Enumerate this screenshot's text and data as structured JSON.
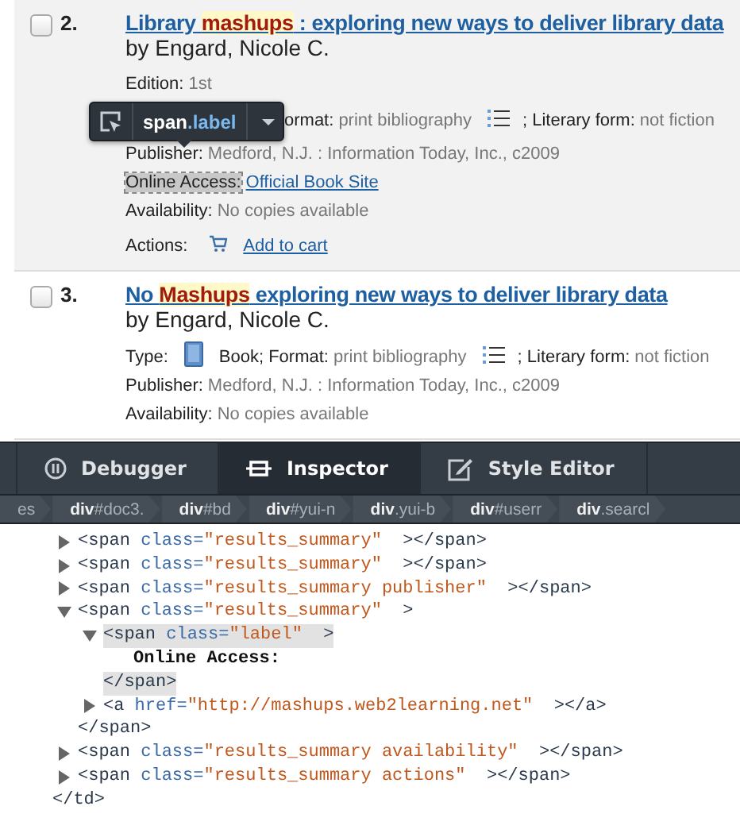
{
  "records": [
    {
      "number": "2.",
      "checked": false,
      "shaded": true,
      "title": [
        {
          "text": "Library ",
          "highlight": false
        },
        {
          "text": "mashups",
          "highlight": true
        },
        {
          "text": " : exploring new ways to deliver library data",
          "highlight": false
        }
      ],
      "author": "by Engard, Nicole C.",
      "rows": [
        {
          "kind": "plain",
          "parts": [
            {
              "kind": "label",
              "text": "Edition:",
              "highlighted": false
            },
            {
              "kind": "value",
              "text": "1st"
            }
          ]
        },
        {
          "kind": "covered",
          "parts": [
            {
              "kind": "label",
              "text": "ormat:",
              "highlighted": false
            },
            {
              "kind": "value",
              "text": "print bibliography"
            },
            {
              "kind": "list"
            },
            {
              "kind": "label",
              "text": "; Literary form:",
              "highlighted": false
            },
            {
              "kind": "value",
              "text": "not fiction"
            }
          ]
        },
        {
          "kind": "plain",
          "parts": [
            {
              "kind": "label",
              "text": "Publisher:",
              "highlighted": false
            },
            {
              "kind": "value",
              "text": "Medford, N.J. : Information Today, Inc., c2009"
            }
          ]
        },
        {
          "kind": "plain",
          "parts": [
            {
              "kind": "label",
              "text": "Online Access:",
              "highlighted": true
            },
            {
              "kind": "link",
              "text": "Official Book Site"
            }
          ]
        },
        {
          "kind": "plain",
          "parts": [
            {
              "kind": "label",
              "text": "Availability:",
              "highlighted": false
            },
            {
              "kind": "value",
              "text": "No copies available"
            }
          ]
        },
        {
          "kind": "actions",
          "parts": [
            {
              "kind": "label",
              "text": "Actions:",
              "highlighted": false
            },
            {
              "kind": "cart"
            },
            {
              "kind": "link",
              "text": "Add to cart"
            }
          ]
        }
      ]
    },
    {
      "number": "3.",
      "checked": false,
      "shaded": false,
      "title": [
        {
          "text": "No ",
          "highlight": false
        },
        {
          "text": "Mashups",
          "highlight": true
        },
        {
          "text": " exploring new ways to deliver library data",
          "highlight": false
        }
      ],
      "author": "by Engard, Nicole C.",
      "rows": [
        {
          "kind": "type",
          "parts": [
            {
              "kind": "label",
              "text": "Type:",
              "highlighted": false
            },
            {
              "kind": "book"
            },
            {
              "kind": "label",
              "text": "Book; Format:",
              "highlighted": false
            },
            {
              "kind": "value",
              "text": "print bibliography"
            },
            {
              "kind": "list"
            },
            {
              "kind": "label",
              "text": "; Literary form:",
              "highlighted": false
            },
            {
              "kind": "value",
              "text": "not fiction"
            }
          ]
        },
        {
          "kind": "plain",
          "parts": [
            {
              "kind": "label",
              "text": "Publisher:",
              "highlighted": false
            },
            {
              "kind": "value",
              "text": "Medford, N.J. : Information Today, Inc., c2009"
            }
          ]
        },
        {
          "kind": "plain",
          "parts": [
            {
              "kind": "label",
              "text": "Availability:",
              "highlighted": false
            },
            {
              "kind": "value",
              "text": "No copies available"
            }
          ]
        }
      ]
    }
  ],
  "picker_tooltip": {
    "tag": "span",
    "class_name": ".label"
  },
  "devtools": {
    "tabs": [
      {
        "label": "Debugger",
        "selected": false
      },
      {
        "label": "Inspector",
        "selected": true
      },
      {
        "label": "Style Editor",
        "selected": false
      }
    ],
    "breadcrumbs": [
      {
        "rest": "es"
      },
      {
        "tag": "div",
        "rest": "#doc3."
      },
      {
        "tag": "div",
        "rest": "#bd"
      },
      {
        "tag": "div",
        "rest": "#yui-n"
      },
      {
        "tag": "div",
        "rest": ".yui-b"
      },
      {
        "tag": "div",
        "rest": "#userr"
      },
      {
        "tag": "div",
        "rest": ".searcl"
      }
    ],
    "tree": {
      "nodes": [
        {
          "kind": "element",
          "expanded": false,
          "selected": false,
          "open": [
            {
              "kind": "tag",
              "text": "<span"
            },
            {
              "kind": "attr",
              "text": " class="
            },
            {
              "kind": "value",
              "text": "\"results_summary\""
            },
            {
              "kind": "tag",
              "text": "  ></span>"
            }
          ]
        },
        {
          "kind": "element",
          "expanded": false,
          "selected": false,
          "open": [
            {
              "kind": "tag",
              "text": "<span"
            },
            {
              "kind": "attr",
              "text": " class="
            },
            {
              "kind": "value",
              "text": "\"results_summary\""
            },
            {
              "kind": "tag",
              "text": "  ></span>"
            }
          ]
        },
        {
          "kind": "element",
          "expanded": false,
          "selected": false,
          "open": [
            {
              "kind": "tag",
              "text": "<span"
            },
            {
              "kind": "attr",
              "text": " class="
            },
            {
              "kind": "value",
              "text": "\"results_summary publisher\""
            },
            {
              "kind": "tag",
              "text": "  ></span>"
            }
          ]
        },
        {
          "kind": "element",
          "expanded": true,
          "selected": false,
          "open": [
            {
              "kind": "tag",
              "text": "<span"
            },
            {
              "kind": "attr",
              "text": " class="
            },
            {
              "kind": "value",
              "text": "\"results_summary\""
            },
            {
              "kind": "tag",
              "text": "  >"
            }
          ],
          "children": [
            {
              "kind": "element",
              "expanded": true,
              "selected": true,
              "open": [
                {
                  "kind": "tag",
                  "text": "<span"
                },
                {
                  "kind": "attr",
                  "text": " class="
                },
                {
                  "kind": "value",
                  "text": "\"label\""
                },
                {
                  "kind": "tag",
                  "text": "  >"
                }
              ],
              "children": [
                {
                  "kind": "text",
                  "text": "Online Access:"
                }
              ],
              "close": [
                {
                  "kind": "tag",
                  "text": "</span>"
                }
              ]
            },
            {
              "kind": "element",
              "expanded": false,
              "selected": false,
              "open": [
                {
                  "kind": "tag",
                  "text": "<a"
                },
                {
                  "kind": "attr",
                  "text": " href="
                },
                {
                  "kind": "value",
                  "text": "\"http://mashups.web2learning.net\""
                },
                {
                  "kind": "tag",
                  "text": "  ></a>"
                }
              ]
            }
          ],
          "close": [
            {
              "kind": "tag",
              "text": "</span>"
            }
          ]
        },
        {
          "kind": "element",
          "expanded": false,
          "selected": false,
          "open": [
            {
              "kind": "tag",
              "text": "<span"
            },
            {
              "kind": "attr",
              "text": " class="
            },
            {
              "kind": "value",
              "text": "\"results_summary availability\""
            },
            {
              "kind": "tag",
              "text": "  ></span>"
            }
          ]
        },
        {
          "kind": "element",
          "expanded": false,
          "selected": false,
          "open": [
            {
              "kind": "tag",
              "text": "<span"
            },
            {
              "kind": "attr",
              "text": " class="
            },
            {
              "kind": "value",
              "text": "\"results_summary actions\""
            },
            {
              "kind": "tag",
              "text": "  ></span>"
            }
          ]
        }
      ],
      "close": [
        {
          "kind": "tag",
          "text": "</td>"
        }
      ]
    }
  }
}
